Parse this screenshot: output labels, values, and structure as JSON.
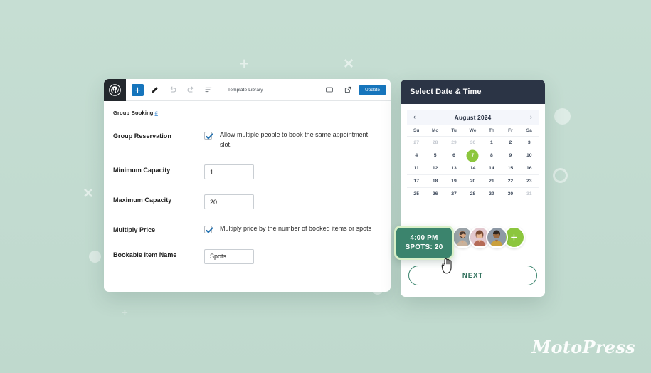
{
  "background": {
    "color": "#c3ddd2",
    "decorations": [
      {
        "type": "plus",
        "name": "deco-plus-top"
      },
      {
        "type": "cross",
        "name": "deco-x-top-right"
      },
      {
        "type": "cross",
        "name": "deco-x-left"
      },
      {
        "type": "dot",
        "name": "deco-dot-left"
      },
      {
        "type": "dot",
        "name": "deco-dot-right"
      },
      {
        "type": "ring",
        "name": "deco-ring-right"
      },
      {
        "type": "dot",
        "name": "deco-dot-bottom"
      }
    ]
  },
  "editor": {
    "toolbar": {
      "logo_name": "wordpress-logo",
      "add_label": "+",
      "template_library_label": "Template Library",
      "update_label": "Update",
      "icons": [
        "pencil-icon",
        "undo-icon",
        "redo-icon",
        "list-view-icon",
        "desktop-icon",
        "external-link-icon"
      ],
      "accent_color": "#1675bc"
    },
    "section": {
      "title": "Group Booking",
      "anchor": "#"
    },
    "fields": [
      {
        "label": "Group Reservation",
        "type": "checkbox",
        "checked": true,
        "description": "Allow multiple people to book the same appointment slot."
      },
      {
        "label": "Minimum Capacity",
        "type": "text",
        "value": "1"
      },
      {
        "label": "Maximum Capacity",
        "type": "text",
        "value": "20"
      },
      {
        "label": "Multiply Price",
        "type": "checkbox",
        "checked": true,
        "description": "Multiply price by the number of booked items or spots"
      },
      {
        "label": "Bookable Item Name",
        "type": "text",
        "value": "Spots"
      }
    ]
  },
  "booking": {
    "header_title": "Select Date & Time",
    "header_color": "#2b3445",
    "calendar": {
      "prev_label": "‹",
      "next_label": "›",
      "month_label": "August 2024",
      "weekdays": [
        "Su",
        "Mo",
        "Tu",
        "We",
        "Th",
        "Fr",
        "Sa"
      ],
      "selected_day": "7",
      "selected_color": "#8cc63e",
      "weeks": [
        [
          {
            "d": "27",
            "muted": true
          },
          {
            "d": "28",
            "muted": true
          },
          {
            "d": "29",
            "muted": true
          },
          {
            "d": "30",
            "muted": true
          },
          {
            "d": "1"
          },
          {
            "d": "2"
          },
          {
            "d": "3"
          }
        ],
        [
          {
            "d": "4"
          },
          {
            "d": "5"
          },
          {
            "d": "6"
          },
          {
            "d": "7",
            "selected": true
          },
          {
            "d": "8"
          },
          {
            "d": "9"
          },
          {
            "d": "10"
          }
        ],
        [
          {
            "d": "11"
          },
          {
            "d": "12"
          },
          {
            "d": "13"
          },
          {
            "d": "14"
          },
          {
            "d": "14"
          },
          {
            "d": "15"
          },
          {
            "d": "16"
          }
        ],
        [
          {
            "d": "17"
          },
          {
            "d": "18"
          },
          {
            "d": "19"
          },
          {
            "d": "20"
          },
          {
            "d": "21"
          },
          {
            "d": "22"
          },
          {
            "d": "23"
          }
        ],
        [
          {
            "d": "25"
          },
          {
            "d": "26"
          },
          {
            "d": "27"
          },
          {
            "d": "28"
          },
          {
            "d": "29"
          },
          {
            "d": "30"
          },
          {
            "d": "31",
            "muted": true
          }
        ]
      ]
    },
    "slot": {
      "time": "4:00 PM",
      "spots": "SPOTS: 20",
      "bg_color": "#3b846d",
      "border_color": "#d9f0c8"
    },
    "avatars": {
      "count": 3,
      "add_label": "+",
      "add_color": "#8cc63e"
    },
    "next_label": "NEXT"
  },
  "brand": {
    "name": "MotoPress"
  }
}
